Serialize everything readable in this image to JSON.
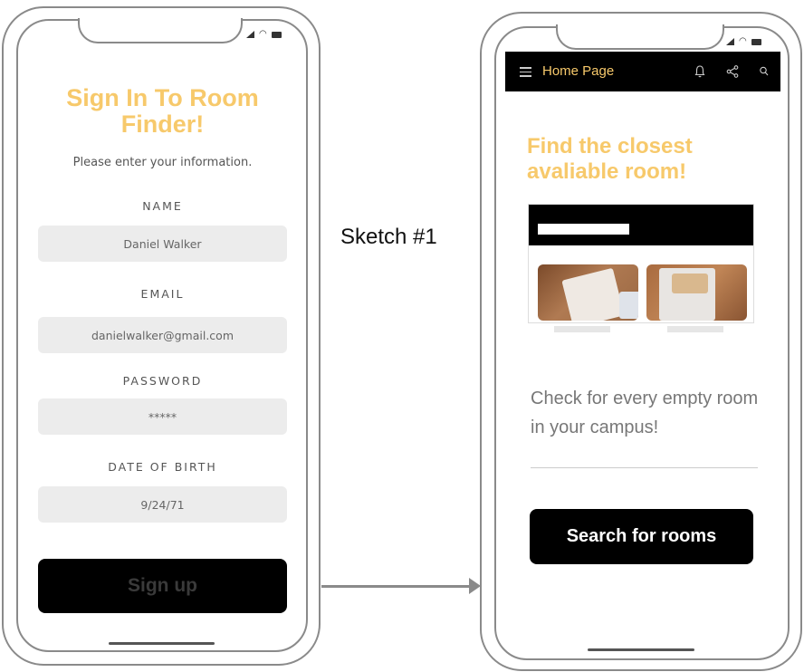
{
  "signup_screen": {
    "title": "Sign In To Room Finder!",
    "subtitle": "Please enter your information.",
    "fields": [
      {
        "label": "NAME",
        "value": "Daniel Walker"
      },
      {
        "label": "EMAIL",
        "value": "danielwalker@gmail.com"
      },
      {
        "label": "PASSWORD",
        "value": "*****"
      },
      {
        "label": "DATE OF BIRTH",
        "value": "9/24/71"
      }
    ],
    "signup_label": "Sign up"
  },
  "sketch_label": "Sketch #1",
  "home_screen": {
    "appbar_title": "Home Page",
    "hero_title": "Find the closest avaliable room!",
    "info_text": "Check for every empty room in your campus!",
    "search_label": "Search for rooms"
  },
  "icons": {
    "menu": "hamburger-menu-icon",
    "notifications": "bell-icon",
    "share": "share-icon",
    "search": "search-icon"
  },
  "colors": {
    "accent": "#f7c96b",
    "button": "#000000",
    "field_bg": "#ececec"
  }
}
